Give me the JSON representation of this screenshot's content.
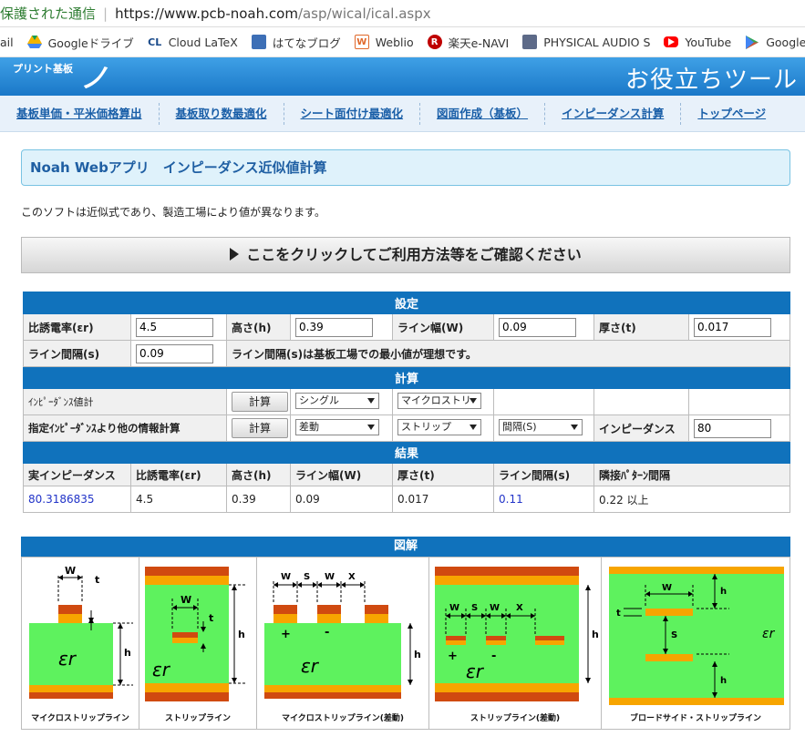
{
  "browser": {
    "secure_label": "保護された通信",
    "url_host": "https://www.pcb-noah.com",
    "url_path": "/asp/wical/ical.aspx",
    "bookmarks": [
      {
        "label": "ail",
        "icon": "mail-icon"
      },
      {
        "label": "Googleドライブ",
        "icon": "drive-icon"
      },
      {
        "label": "Cloud LaTeX",
        "icon": "cl-icon"
      },
      {
        "label": "はてなブログ",
        "icon": "hatena-icon"
      },
      {
        "label": "Weblio",
        "icon": "weblio-icon"
      },
      {
        "label": "楽天e-NAVI",
        "icon": "rakuten-icon"
      },
      {
        "label": "PHYSICAL AUDIO S",
        "icon": "physical-audio-icon"
      },
      {
        "label": "YouTube",
        "icon": "youtube-icon"
      },
      {
        "label": "Google Play M",
        "icon": "play-icon"
      }
    ]
  },
  "site": {
    "logo_small": "プリント基板",
    "logo_big": "ノア",
    "header_title": "お役立ちツール",
    "nav": [
      "基板単価・平米価格算出",
      "基板取り数最適化",
      "シート面付け最適化",
      "図面作成（基板）",
      "インピーダンス計算",
      "トップページ"
    ]
  },
  "page": {
    "title": "Noah Webアプリ　インピーダンス近似値計算",
    "note": "このソフトは近似式であり、製造工場により値が異なります。",
    "howto": "ここをクリックしてご利用方法等をご確認ください"
  },
  "settings": {
    "header": "設定",
    "er_label": "比誘電率(εr)",
    "er_value": "4.5",
    "h_label": "高さ(h)",
    "h_value": "0.39",
    "w_label": "ライン幅(W)",
    "w_value": "0.09",
    "t_label": "厚さ(t)",
    "t_value": "0.017",
    "s_label": "ライン間隔(s)",
    "s_value": "0.09",
    "s_note": "ライン間隔(s)は基板工場での最小値が理想です。"
  },
  "calc": {
    "header": "計算",
    "row1_label": "ｲﾝﾋﾟｰﾀﾞﾝｽ値計",
    "row1_button": "計算",
    "row1_sel1": "シングル",
    "row1_sel2": "マイクロストリ",
    "row2_label": "指定ｲﾝﾋﾟｰﾀﾞﾝｽより他の情報計算",
    "row2_button": "計算",
    "row2_sel1": "差動",
    "row2_sel2": "ストリップ",
    "row2_sel3": "間隔(S)",
    "row2_imp_label": "インピーダンス",
    "row2_imp_value": "80"
  },
  "results": {
    "header": "結果",
    "columns": [
      "実インピーダンス",
      "比誘電率(εr)",
      "高さ(h)",
      "ライン幅(W)",
      "厚さ(t)",
      "ライン間隔(s)",
      "隣接ﾊﾟﾀｰﾝ間隔"
    ],
    "values": [
      "80.3186835",
      "4.5",
      "0.39",
      "0.09",
      "0.017",
      "0.11",
      "0.22 以上"
    ]
  },
  "diagram": {
    "header": "図解",
    "captions": [
      "マイクロストリップライン",
      "ストリップライン",
      "マイクロストリップライン(差動)",
      "ストリップライン(差動)",
      "ブロードサイド・ストリップライン"
    ],
    "labels": {
      "w": "W",
      "t": "t",
      "h": "h",
      "s": "S",
      "x": "X",
      "er": "εr"
    },
    "colors": {
      "substrate": "#5ef25e",
      "copper": "#f7a500",
      "copper_dark": "#d04a10"
    }
  }
}
